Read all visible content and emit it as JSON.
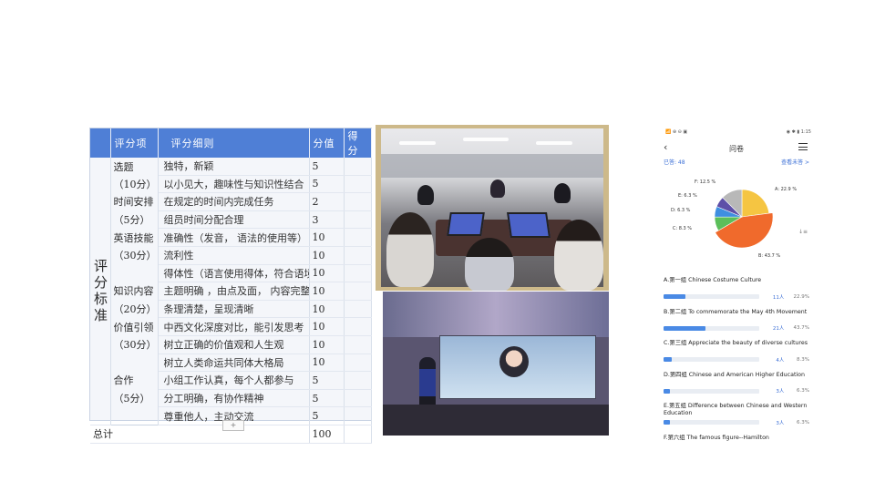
{
  "rubric": {
    "headers": [
      "评分项",
      "评分细则",
      "分值",
      "得分"
    ],
    "side_label": "评分标准",
    "rows": [
      {
        "cat": "选题",
        "item": "独特，新颖",
        "score": "5"
      },
      {
        "cat": "（10分）",
        "item": "以小见大，趣味性与知识性结合",
        "score": "5"
      },
      {
        "cat": "时间安排",
        "item": "在规定的时间内完成任务",
        "score": "2"
      },
      {
        "cat": "（5分）",
        "item": "组员时间分配合理",
        "score": "3"
      },
      {
        "cat": "英语技能",
        "item": "准确性（发音， 语法的使用等）",
        "score": "10"
      },
      {
        "cat": "（30分）",
        "item": "流利性",
        "score": "10"
      },
      {
        "cat": "",
        "item": "得体性（语言使用得体，符合语境）",
        "score": "10"
      },
      {
        "cat": "知识内容",
        "item": "主题明确 ，由点及面， 内容完整",
        "score": "10"
      },
      {
        "cat": "（20分）",
        "item": "条理清楚，呈现清晰",
        "score": "10"
      },
      {
        "cat": "价值引领",
        "item": "中西文化深度对比，能引发思考",
        "score": "10"
      },
      {
        "cat": "（30分）",
        "item": "树立正确的价值观和人生观",
        "score": "10"
      },
      {
        "cat": "",
        "item": "树立人类命运共同体大格局",
        "score": "10"
      },
      {
        "cat": "合作",
        "item": "小组工作认真，每个人都参与",
        "score": "5"
      },
      {
        "cat": "（5分）",
        "item": "分工明确，有协作精神",
        "score": "5"
      },
      {
        "cat": "",
        "item": "尊重他人，主动交流",
        "score": "5"
      }
    ],
    "total_label": "总计",
    "total_value": "100"
  },
  "survey": {
    "status_left": "📶 ⊕ ⊖ ▣",
    "status_right": "◉ ✱ ▮ 1:15",
    "title": "问卷",
    "answered": "已答: 48",
    "view_unanswered": "查看未答 >",
    "colors": {
      "A": "#f5c542",
      "B": "#f06a2c",
      "C": "#5bbf5a",
      "D": "#3f8fe0",
      "E": "#5e4fa8",
      "F": "#b8b8b8"
    },
    "options": [
      {
        "key": "A",
        "text": "A.第一组 Chinese Costume Culture",
        "count": "11人",
        "pct": "22.9%",
        "value": 22.9
      },
      {
        "key": "B",
        "text": "B.第二组 To commemorate the May 4th Movement",
        "count": "21人",
        "pct": "43.7%",
        "value": 43.7
      },
      {
        "key": "C",
        "text": "C.第三组 Appreciate the beauty of diverse cultures",
        "count": "4人",
        "pct": "8.3%",
        "value": 8.3
      },
      {
        "key": "D",
        "text": "D.第四组 Chinese and American Higher Education",
        "count": "3人",
        "pct": "6.3%",
        "value": 6.3
      },
      {
        "key": "E",
        "text": "E.第五组 Difference between Chinese and Western Education",
        "count": "3人",
        "pct": "6.3%",
        "value": 6.3
      },
      {
        "key": "F",
        "text": "F.第六组 The famous figure--Hamilton",
        "count": "",
        "pct": "",
        "value": 12.5
      }
    ],
    "pie_labels": [
      "A: 22.9 %",
      "B: 43.7 %",
      "C: 8.3 %",
      "D: 6.3 %",
      "E: 6.3 %",
      "F: 12.5 %"
    ]
  }
}
